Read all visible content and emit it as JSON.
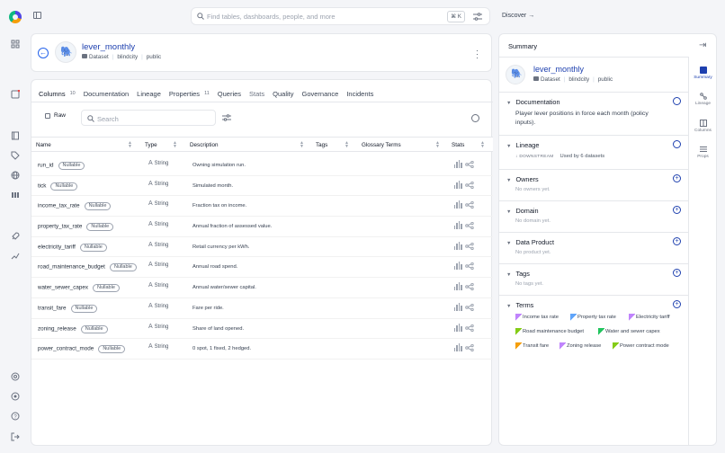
{
  "top": {
    "search_placeholder": "Find tables, dashboards, people, and more",
    "shortcut": "⌘ K",
    "discover": "Discover"
  },
  "entity": {
    "title": "lever_monthly",
    "type": "Dataset",
    "platform": "blindcity",
    "schema": "public"
  },
  "tabs": [
    {
      "label": "Columns",
      "count": "10"
    },
    {
      "label": "Documentation"
    },
    {
      "label": "Lineage"
    },
    {
      "label": "Properties",
      "count": "11"
    },
    {
      "label": "Queries"
    },
    {
      "label": "Stats"
    },
    {
      "label": "Quality"
    },
    {
      "label": "Governance"
    },
    {
      "label": "Incidents"
    }
  ],
  "toolbar": {
    "raw_label": "Raw",
    "search_placeholder": "Search"
  },
  "table": {
    "headers": {
      "name": "Name",
      "type": "Type",
      "description": "Description",
      "tags": "Tags",
      "glossary": "Glossary Terms",
      "stats": "Stats"
    },
    "rows": [
      {
        "name": "run_id",
        "badge": "Nullable",
        "type": "String",
        "desc": "Owning simulation run."
      },
      {
        "name": "tick",
        "badge": "Nullable",
        "type": "String",
        "desc": "Simulated month."
      },
      {
        "name": "income_tax_rate",
        "badge": "Nullable",
        "type": "String",
        "desc": "Fraction tax on income."
      },
      {
        "name": "property_tax_rate",
        "badge": "Nullable",
        "type": "String",
        "desc": "Annual fraction of assessed value."
      },
      {
        "name": "electricity_tariff",
        "badge": "Nullable",
        "type": "String",
        "desc": "Retail currency per kWh."
      },
      {
        "name": "road_maintenance_budget",
        "badge": "Nullable",
        "type": "String",
        "desc": "Annual road spend."
      },
      {
        "name": "water_sewer_capex",
        "badge": "Nullable",
        "type": "String",
        "desc": "Annual water/sewer capital."
      },
      {
        "name": "transit_fare",
        "badge": "Nullable",
        "type": "String",
        "desc": "Fare per ride."
      },
      {
        "name": "zoning_release",
        "badge": "Nullable",
        "type": "String",
        "desc": "Share of land opened."
      },
      {
        "name": "power_contract_mode",
        "badge": "Nullable",
        "type": "String",
        "desc": "0 spot, 1 fixed, 2 hedged."
      }
    ]
  },
  "panel": {
    "title": "Summary",
    "side_tabs": [
      "Summary",
      "Lineage",
      "Columns",
      "Props"
    ],
    "documentation": {
      "title": "Documentation",
      "text": "Player lever positions in force each month (policy inputs)."
    },
    "lineage": {
      "title": "Lineage",
      "direction": "DOWNSTREAM",
      "used_by": "Used by 6 datasets"
    },
    "owners": {
      "title": "Owners",
      "empty": "No owners yet."
    },
    "domain": {
      "title": "Domain",
      "empty": "No domain yet."
    },
    "data_product": {
      "title": "Data Product",
      "empty": "No product yet."
    },
    "tags": {
      "title": "Tags",
      "empty": "No tags yet."
    },
    "terms": {
      "title": "Terms",
      "items": [
        "Income tax rate",
        "Property tax rate",
        "Electricity tariff",
        "Road maintenance budget",
        "Water and sewer capex",
        "Transit fare",
        "Zoning release",
        "Power contract mode"
      ]
    }
  },
  "colors": {
    "accent": "#1e40af",
    "link": "#2563eb"
  }
}
